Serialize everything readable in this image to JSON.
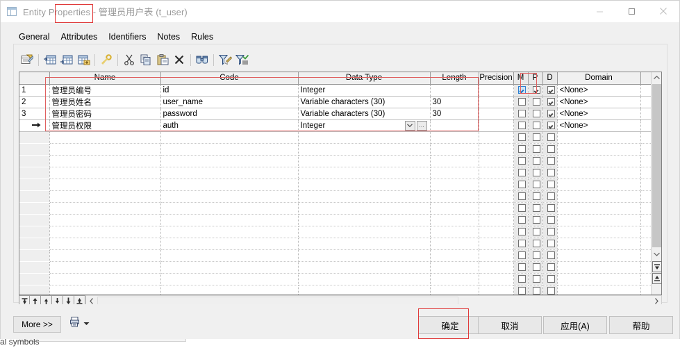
{
  "window": {
    "title": "Entity Properties - 管理员用户表 (t_user)",
    "icon": "table-icon",
    "minimize": "minimize-icon",
    "maximize": "maximize-icon",
    "close": "close-icon"
  },
  "tabs": [
    {
      "label": "General",
      "selected": false
    },
    {
      "label": "Attributes",
      "selected": true
    },
    {
      "label": "Identifiers",
      "selected": false
    },
    {
      "label": "Notes",
      "selected": false
    },
    {
      "label": "Rules",
      "selected": false
    }
  ],
  "toolbar": {
    "buttons": [
      {
        "name": "properties-icon",
        "tip": "Properties"
      },
      {
        "sep": true
      },
      {
        "name": "insert-row-icon",
        "tip": "Insert a Row"
      },
      {
        "name": "add-row-icon",
        "tip": "Add a Row"
      },
      {
        "name": "add-new-icon",
        "tip": "Create an Object"
      },
      {
        "sep": true
      },
      {
        "name": "key-icon",
        "tip": "Primary Key"
      },
      {
        "sep": true
      },
      {
        "name": "cut-icon",
        "tip": "Cut"
      },
      {
        "name": "copy-icon",
        "tip": "Copy"
      },
      {
        "name": "paste-icon",
        "tip": "Paste"
      },
      {
        "name": "delete-icon",
        "tip": "Delete"
      },
      {
        "sep": true
      },
      {
        "name": "find-icon",
        "tip": "Find"
      },
      {
        "sep": true
      },
      {
        "name": "customize-filter-icon",
        "tip": "Customize Columns and Filter"
      },
      {
        "name": "apply-filter-icon",
        "tip": "Apply Filter"
      }
    ]
  },
  "grid": {
    "columns": [
      {
        "key": "num",
        "label": "",
        "width": 43
      },
      {
        "key": "name",
        "label": "Name",
        "width": 160
      },
      {
        "key": "code",
        "label": "Code",
        "width": 198
      },
      {
        "key": "type",
        "label": "Data Type",
        "width": 190
      },
      {
        "key": "len",
        "label": "Length",
        "width": 70
      },
      {
        "key": "prec",
        "label": "Precision",
        "width": 50
      },
      {
        "key": "m",
        "label": "M",
        "width": 21
      },
      {
        "key": "p",
        "label": "P",
        "width": 21
      },
      {
        "key": "d",
        "label": "D",
        "width": 21
      },
      {
        "key": "dom",
        "label": "Domain",
        "width": 120
      },
      {
        "key": "pad",
        "label": "",
        "width": 16
      }
    ],
    "rows": [
      {
        "num": "1",
        "marker": "",
        "name": "管理员编号",
        "code": "id",
        "type": "Integer",
        "len": "",
        "prec": "",
        "m": true,
        "p": true,
        "d": true,
        "dom": "<None>",
        "m_selected": true
      },
      {
        "num": "2",
        "marker": "",
        "name": "管理员姓名",
        "code": "user_name",
        "type": "Variable characters (30)",
        "len": "30",
        "prec": "",
        "m": false,
        "p": false,
        "d": true,
        "dom": "<None>",
        "m_selected": false
      },
      {
        "num": "3",
        "marker": "",
        "name": "管理员密码",
        "code": "password",
        "type": "Variable characters (30)",
        "len": "30",
        "prec": "",
        "m": false,
        "p": false,
        "d": true,
        "dom": "<None>",
        "m_selected": false
      },
      {
        "num": "",
        "marker": "➡",
        "name": "管理员权限",
        "code": "auth",
        "type": "Integer",
        "len": "",
        "prec": "",
        "m": false,
        "p": false,
        "d": true,
        "dom": "<None>",
        "m_selected": false,
        "editing": true
      }
    ],
    "empty_row_count": 14,
    "editor": {
      "dropdown": "chevron-down-icon",
      "browse": "…"
    },
    "vscroll": {
      "up": "scroll-up-icon",
      "down": "scroll-down-icon",
      "goto_top": "goto-top-icon",
      "goto_bottom": "goto-bottom-icon"
    },
    "move_buttons": [
      {
        "name": "move-first-icon",
        "glyph": "⤒"
      },
      {
        "name": "move-up-many-icon",
        "glyph": "⇑"
      },
      {
        "name": "move-up-icon",
        "glyph": "↑"
      },
      {
        "name": "move-down-icon",
        "glyph": "↓"
      },
      {
        "name": "move-down-many-icon",
        "glyph": "⇓"
      },
      {
        "name": "move-last-icon",
        "glyph": "⤓"
      }
    ],
    "hscroll": {
      "left": "scroll-left-icon",
      "right": "scroll-right-icon"
    }
  },
  "footer": {
    "more_label": "More >>",
    "print_icon": "print-list-icon",
    "print_dropdown": "chevron-down-icon",
    "ok_label": "确定",
    "cancel_label": "取消",
    "apply_label": "应用(A)",
    "help_label": "帮助"
  },
  "annotations": {
    "tab_box_color": "#e03a3a",
    "grid_box_color": "#e06060",
    "ok_box_color": "#e03a3a"
  },
  "background": {
    "bleed_text": "al symbols"
  }
}
